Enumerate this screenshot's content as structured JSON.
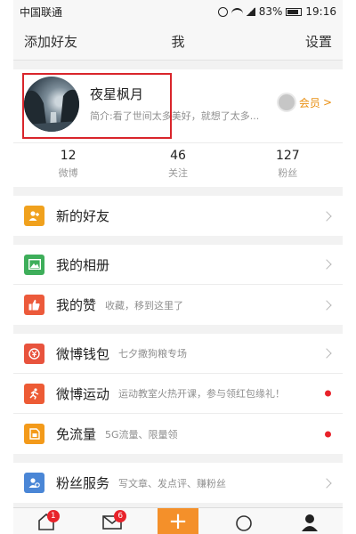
{
  "status": {
    "carrier": "中国联通",
    "battery": "83%",
    "time": "19:16"
  },
  "nav": {
    "left": "添加好友",
    "title": "我",
    "right": "设置"
  },
  "profile": {
    "nickname": "夜星枫月",
    "bio": "简介:看了世间太多美好，就想了太多...",
    "vip": "会员"
  },
  "stats": [
    {
      "count": "12",
      "label": "微博"
    },
    {
      "count": "46",
      "label": "关注"
    },
    {
      "count": "127",
      "label": "粉丝"
    }
  ],
  "menu": {
    "new_friends": {
      "label": "新的好友",
      "color": "#f0a11d"
    },
    "albums": {
      "label": "我的相册",
      "color": "#3eae5a"
    },
    "likes": {
      "label": "我的赞",
      "sub": "收藏，移到这里了",
      "color": "#ec5a3b"
    },
    "wallet": {
      "label": "微博钱包",
      "sub": "七夕撒狗粮专场",
      "color": "#e8533d"
    },
    "sports": {
      "label": "微博运动",
      "sub": "运动教室火热开课，参与领红包缘礼！",
      "color": "#ed5b35"
    },
    "traffic": {
      "label": "免流量",
      "sub": "5G流量、限量领",
      "color": "#f39a1a"
    },
    "fans": {
      "label": "粉丝服务",
      "sub": "写文章、发点评、赚粉丝",
      "color": "#4a86d6"
    }
  },
  "tabs": {
    "home_badge": "1",
    "message_badge": "6",
    "compose": "+"
  }
}
